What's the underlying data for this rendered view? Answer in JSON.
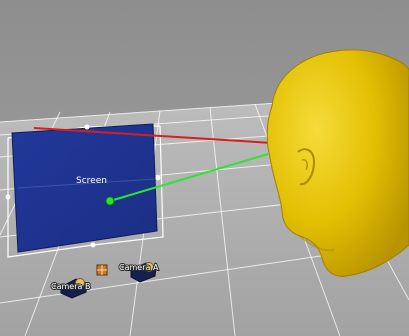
{
  "viewport": {
    "background_color": "#9a9a9a",
    "floor_color": "#a5a5a5",
    "grid_color": "#ffffff"
  },
  "screen": {
    "label": "Screen",
    "fill_color": "#1f3592",
    "frame_color": "#ffffff"
  },
  "rays": {
    "red_color": "#d81e1e",
    "green_color": "#2be62b"
  },
  "cameras": [
    {
      "label": "Camera A"
    },
    {
      "label": "Camera B"
    }
  ],
  "head": {
    "fill_color": "#e7c300"
  }
}
